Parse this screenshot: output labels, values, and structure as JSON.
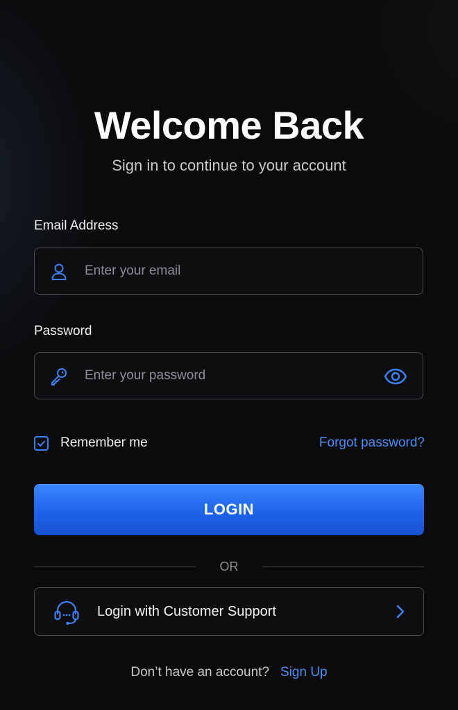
{
  "header": {
    "title": "Welcome Back",
    "subtitle": "Sign in to continue to your account"
  },
  "form": {
    "email": {
      "label": "Email Address",
      "placeholder": "Enter your email",
      "value": "",
      "icon": "user-icon"
    },
    "password": {
      "label": "Password",
      "placeholder": "Enter your password",
      "value": "",
      "icon": "key-icon",
      "toggle_icon": "eye-icon"
    },
    "remember": {
      "label": "Remember me",
      "checked": true
    },
    "forgot_label": "Forgot password?",
    "login_label": "LOGIN"
  },
  "divider": {
    "label": "OR"
  },
  "support": {
    "label": "Login with Customer Support",
    "icon": "headset-icon",
    "chevron_icon": "chevron-right-icon"
  },
  "footer": {
    "prompt": "Don’t have an account?",
    "signup_label": "Sign Up"
  },
  "colors": {
    "background": "#0b0b0c",
    "accent": "#3b82f6",
    "link": "#4c8df6",
    "border": "#4b4b52"
  }
}
